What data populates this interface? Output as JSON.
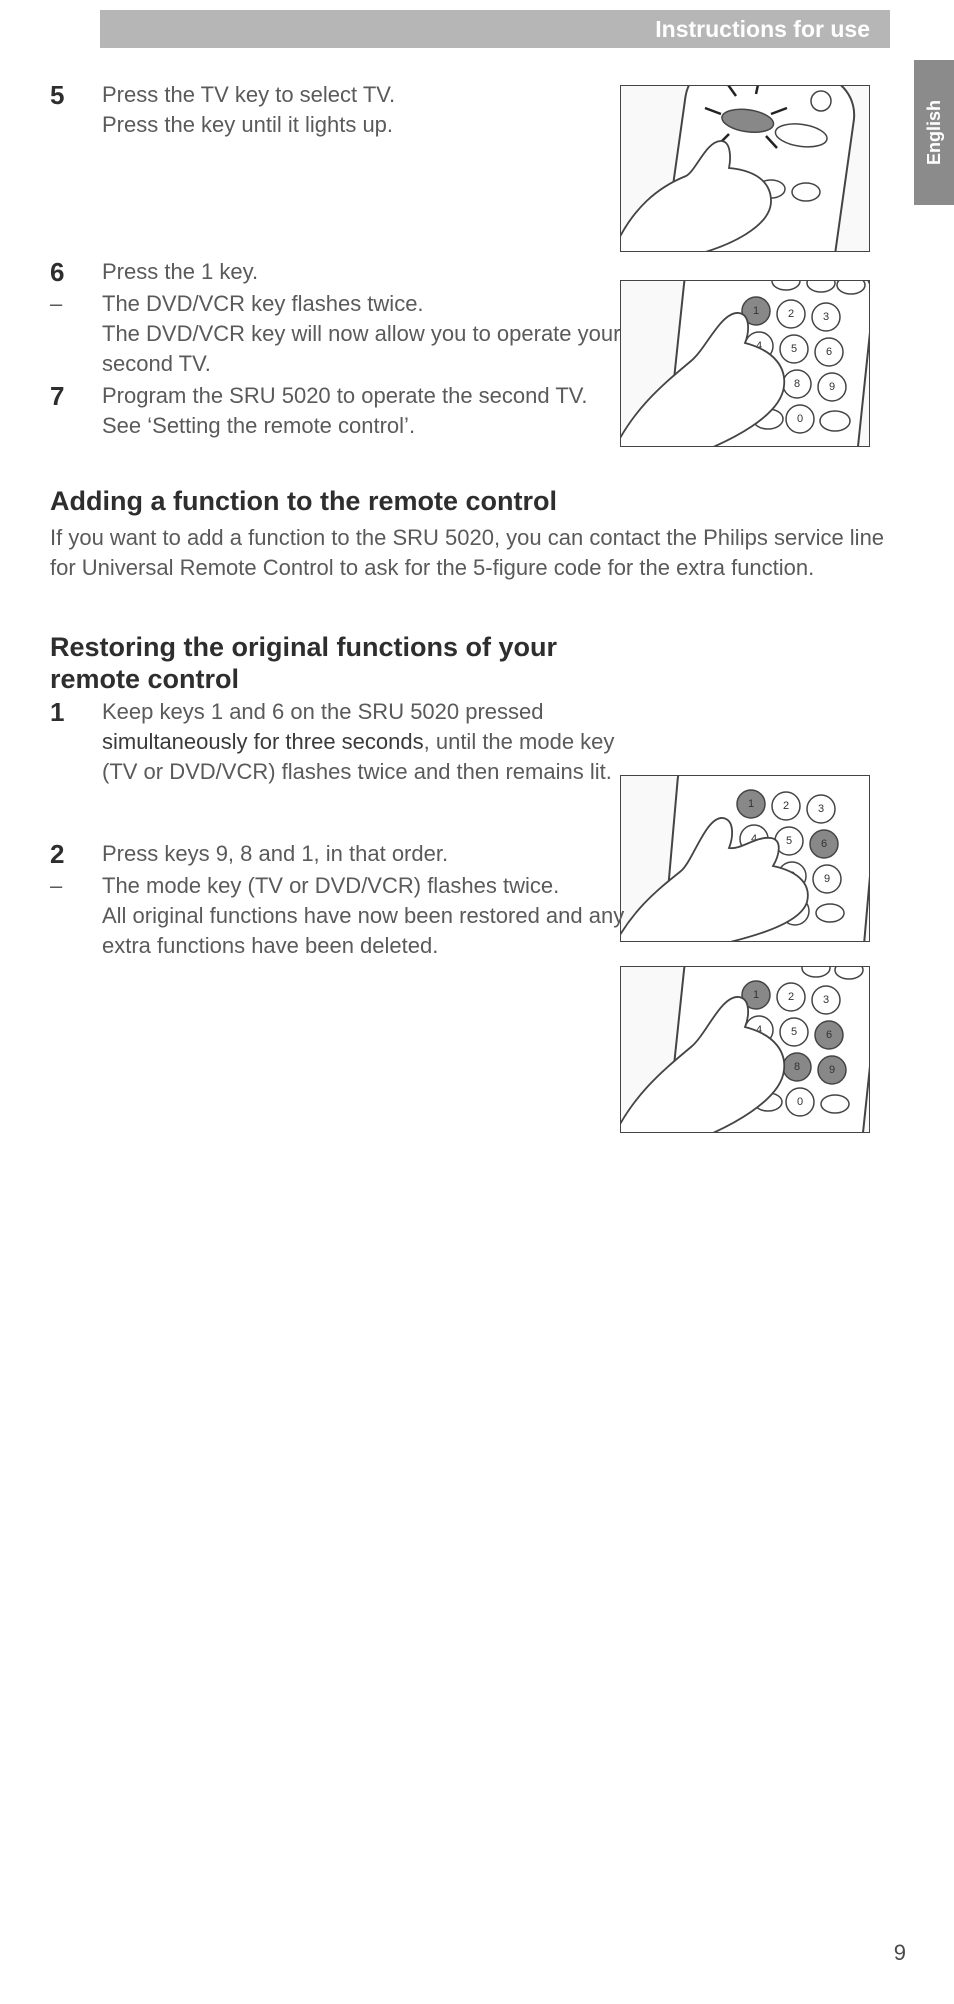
{
  "header": {
    "title": "Instructions for use"
  },
  "lang_tab": "English",
  "steps_a": [
    {
      "num": "5",
      "lines": [
        "Press the TV key to select TV.",
        "Press the key until it lights up."
      ]
    },
    {
      "num": "6",
      "lines": [
        "Press the 1 key."
      ]
    },
    {
      "num": "–",
      "lines": [
        "The DVD/VCR key flashes twice.",
        "The DVD/VCR key will now allow you to operate your second TV."
      ]
    },
    {
      "num": "7",
      "lines": [
        "Program the SRU 5020 to operate the second TV.",
        "See ‘Setting the remote control’."
      ]
    }
  ],
  "section_add": {
    "heading": "Adding a function to the remote control",
    "para": "If you want to add a function to the SRU 5020, you can contact the Philips service line for Universal Remote Control to ask for the 5-figure code for the extra function."
  },
  "section_restore": {
    "heading": "Restoring the original functions of your remote control",
    "steps": [
      {
        "num": "1",
        "pre": "Keep keys 1 and 6 on the SRU 5020 pressed ",
        "bold": "simultaneously for three seconds",
        "post": ", until the mode key (TV or DVD/VCR) flashes twice and then remains lit."
      },
      {
        "num": "2",
        "lines": [
          "Press keys 9, 8 and 1, in that order."
        ]
      },
      {
        "num": "–",
        "lines": [
          "The mode key (TV or DVD/VCR) flashes twice.",
          "All original functions have now been restored and any extra functions have been deleted."
        ]
      }
    ]
  },
  "page_number": "9",
  "icons": {
    "fig1": "remote-tv-select",
    "fig2": "remote-press-1",
    "fig3": "remote-keys-1-6",
    "fig4": "remote-press-981"
  }
}
